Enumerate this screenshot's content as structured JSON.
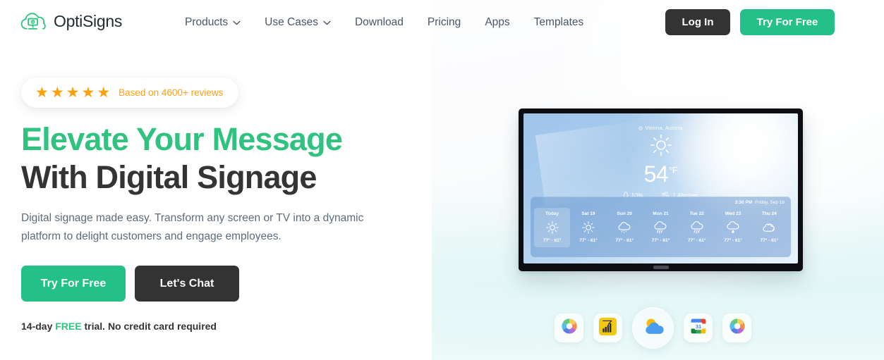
{
  "brand": {
    "name": "OptiSigns",
    "logo_icon": "cloud-screen-power-icon",
    "accent": "#2fc37f"
  },
  "nav": {
    "items": [
      {
        "label": "Products",
        "has_dropdown": true
      },
      {
        "label": "Use Cases",
        "has_dropdown": true
      },
      {
        "label": "Download",
        "has_dropdown": false
      },
      {
        "label": "Pricing",
        "has_dropdown": false
      },
      {
        "label": "Apps",
        "has_dropdown": false
      },
      {
        "label": "Templates",
        "has_dropdown": false
      }
    ],
    "login_label": "Log In",
    "try_label": "Try For Free"
  },
  "hero": {
    "rating": {
      "stars": "★★★★★",
      "text": "Based on 4600+ reviews",
      "color": "#fba113"
    },
    "headline_line1": "Elevate Your Message",
    "headline_line2": "With Digital Signage",
    "subhead": "Digital signage made easy. Transform any screen or TV into a dynamic platform to delight customers and engage employees.",
    "cta_primary": "Try For Free",
    "cta_secondary": "Let's Chat",
    "trial_prefix": "14-day ",
    "trial_free": "FREE",
    "trial_suffix": " trial. No credit card required"
  },
  "tv": {
    "weather": {
      "location": "Vienna, Austria",
      "condition_icon": "sun-icon",
      "temperature": "54",
      "unit": "°F",
      "humidity": "53%",
      "wind": "1.48m/sec",
      "time": "3:30 PM",
      "date": "Friday, Sep 18",
      "forecast": [
        {
          "day": "Today",
          "icon": "sun-icon",
          "range": "77° - 61°",
          "active": true
        },
        {
          "day": "Sat 19",
          "icon": "sun-icon",
          "range": "77° - 61°",
          "active": false
        },
        {
          "day": "Sun 20",
          "icon": "cloud-snow-icon",
          "range": "77° - 61°",
          "active": false
        },
        {
          "day": "Mon 21",
          "icon": "cloud-rain-icon",
          "range": "77° - 61°",
          "active": false
        },
        {
          "day": "Tue 22",
          "icon": "cloud-rain-icon",
          "range": "77° - 61°",
          "active": false
        },
        {
          "day": "Wed 23",
          "icon": "cloud-drop-icon",
          "range": "77° - 61°",
          "active": false
        },
        {
          "day": "Thu 24",
          "icon": "cloudy-icon",
          "range": "77° - 61°",
          "active": false
        }
      ]
    }
  },
  "apps": [
    {
      "name": "color-wheel-app-icon",
      "featured": false
    },
    {
      "name": "power-bi-app-icon",
      "featured": false
    },
    {
      "name": "weather-app-icon",
      "featured": true
    },
    {
      "name": "google-calendar-app-icon",
      "featured": false
    },
    {
      "name": "color-wheel-app-icon-2",
      "featured": false
    }
  ]
}
